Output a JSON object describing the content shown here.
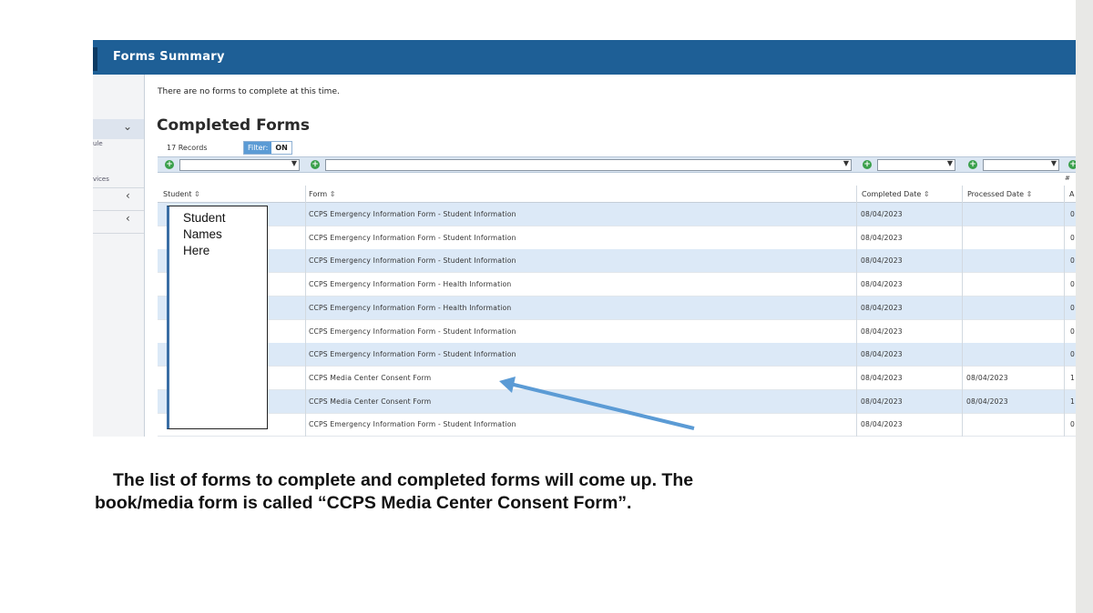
{
  "header": {
    "title": "Forms Summary"
  },
  "sidebar": {
    "fragment_1": "ule",
    "fragment_2": "vices"
  },
  "notice": "There are no forms to complete at this time.",
  "completed_forms": {
    "title": "Completed Forms",
    "records": "17 Records",
    "filter_label": "Filter:",
    "filter_value": "ON",
    "extra_header": "#",
    "columns": {
      "student": "Student",
      "form": "Form",
      "completed": "Completed Date",
      "processed": "Processed Date",
      "last": "A"
    },
    "rows": [
      {
        "form": "CCPS Emergency Information Form - Student Information",
        "completed": "08/04/2023",
        "processed": "",
        "last": "0"
      },
      {
        "form": "CCPS Emergency Information Form - Student Information",
        "completed": "08/04/2023",
        "processed": "",
        "last": "0"
      },
      {
        "form": "CCPS Emergency Information Form - Student Information",
        "completed": "08/04/2023",
        "processed": "",
        "last": "0"
      },
      {
        "form": "CCPS Emergency Information Form - Health Information",
        "completed": "08/04/2023",
        "processed": "",
        "last": "0"
      },
      {
        "form": "CCPS Emergency Information Form - Health Information",
        "completed": "08/04/2023",
        "processed": "",
        "last": "0"
      },
      {
        "form": "CCPS Emergency Information Form - Student Information",
        "completed": "08/04/2023",
        "processed": "",
        "last": "0"
      },
      {
        "form": "CCPS Emergency Information Form - Student Information",
        "completed": "08/04/2023",
        "processed": "",
        "last": "0"
      },
      {
        "form": "CCPS Media Center Consent Form",
        "completed": "08/04/2023",
        "processed": "08/04/2023",
        "last": "1"
      },
      {
        "form": "CCPS Media Center Consent Form",
        "completed": "08/04/2023",
        "processed": "08/04/2023",
        "last": "1"
      },
      {
        "form": "CCPS Emergency Information Form - Student Information",
        "completed": "08/04/2023",
        "processed": "",
        "last": "0"
      }
    ]
  },
  "annotation": {
    "names_line1": "Student",
    "names_line2": "Names",
    "names_line3": "Here",
    "arrow_color": "#5b9bd5"
  },
  "caption": {
    "line1": "The list of forms to complete and completed forms will come up. The",
    "line2": "book/media form is called “CCPS Media Center Consent Form”."
  },
  "colors": {
    "header_bg": "#1e5f96",
    "row_alt_bg": "#dce9f7",
    "filter_bg": "#dbe6f2",
    "plus_green": "#3aa04b"
  }
}
